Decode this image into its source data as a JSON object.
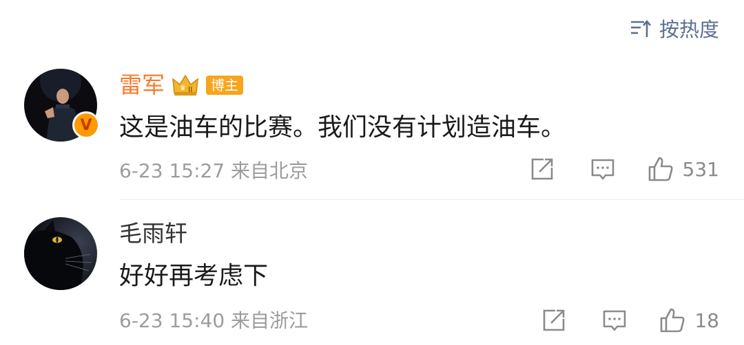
{
  "sort": {
    "label": "按热度",
    "icon": "sort-icon"
  },
  "comments": [
    {
      "name": "雷军",
      "badge": "博主",
      "text": "这是油车的比赛。我们没有计划造油车。",
      "time_location": "6-23 15:27 来自北京",
      "likes": "531",
      "verified": true
    },
    {
      "name": "毛雨轩",
      "text": "好好再考虑下",
      "time_location": "6-23 15:40 来自浙江",
      "likes": "18"
    }
  ],
  "colors": {
    "highlight_name": "#f77c2b",
    "sort_blue": "#5b6f8f",
    "meta_gray": "#9c9c9c"
  }
}
